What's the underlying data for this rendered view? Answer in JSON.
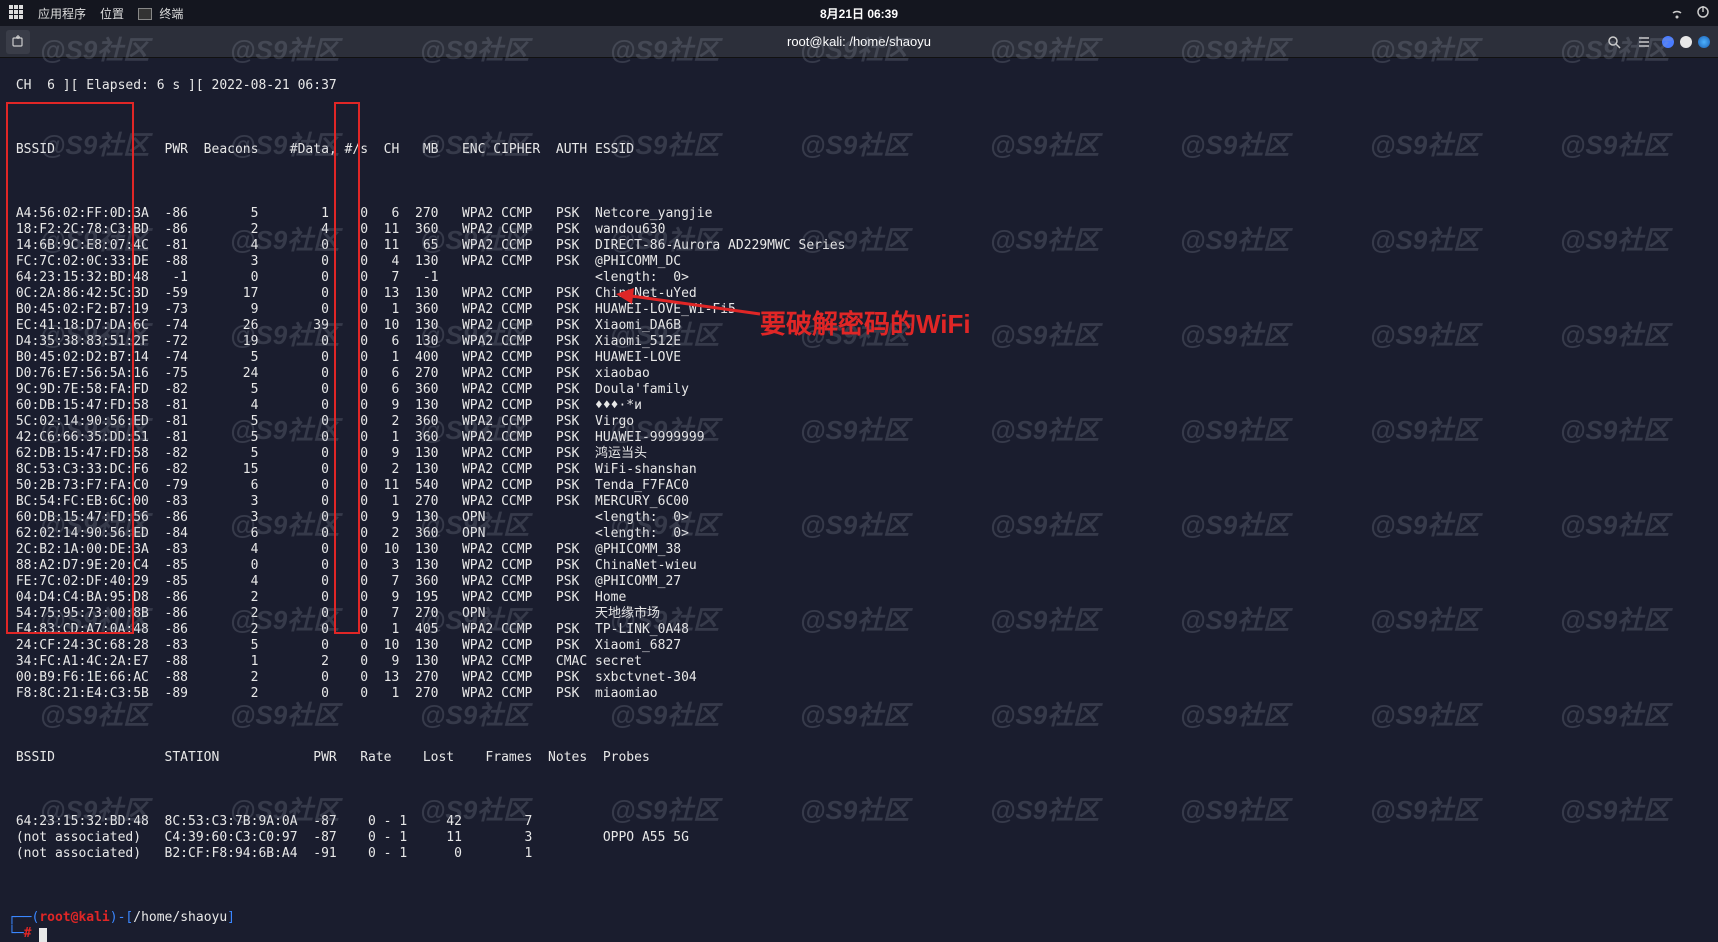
{
  "topbar": {
    "apps": "应用程序",
    "places": "位置",
    "terminal": "终端",
    "clock": "8月21日 06:39"
  },
  "titlebar": {
    "title": "root@kali: /home/shaoyu"
  },
  "watermark_text": "@S9社区",
  "header_line": " CH  6 ][ Elapsed: 6 s ][ 2022-08-21 06:37",
  "columns_ap": " BSSID              PWR  Beacons    #Data, #/s  CH   MB   ENC CIPHER  AUTH ESSID",
  "ap_rows": [
    " A4:56:02:FF:0D:3A  -86        5        1    0   6  270   WPA2 CCMP   PSK  Netcore_yangjie",
    " 18:F2:2C:78:C3:BD  -86        2        4    0  11  360   WPA2 CCMP   PSK  wandou630",
    " 14:6B:9C:E8:07:4C  -81        4        0    0  11   65   WPA2 CCMP   PSK  DIRECT-86-Aurora AD229MWC Series",
    " FC:7C:02:0C:33:DE  -88        3        0    0   4  130   WPA2 CCMP   PSK  @PHICOMM_DC",
    " 64:23:15:32:BD:48   -1        0        0    0   7   -1                    <length:  0>",
    " 0C:2A:86:42:5C:3D  -59       17        0    0  13  130   WPA2 CCMP   PSK  ChinaNet-uYed",
    " B0:45:02:F2:B7:19  -73        9        0    0   1  360   WPA2 CCMP   PSK  HUAWEI-LOVE_Wi-Fi5",
    " EC:41:18:D7:DA:6C  -74       26       39    0  10  130   WPA2 CCMP   PSK  Xiaomi_DA6B",
    " D4:35:38:83:51:2F  -72       19        0    0   6  130   WPA2 CCMP   PSK  Xiaomi_512E",
    " B0:45:02:D2:B7:14  -74        5        0    0   1  400   WPA2 CCMP   PSK  HUAWEI-LOVE",
    " D0:76:E7:56:5A:16  -75       24        0    0   6  270   WPA2 CCMP   PSK  xiaobao",
    " 9C:9D:7E:58:FA:FD  -82        5        0    0   6  360   WPA2 CCMP   PSK  Doula'family",
    " 60:DB:15:47:FD:58  -81        4        0    0   9  130   WPA2 CCMP   PSK  ♦♦♦·*и",
    " 5C:02:14:90:56:ED  -81        5        0    0   2  360   WPA2 CCMP   PSK  Virgo",
    " 42:C6:66:35:DD:51  -81        5        0    0   1  360   WPA2 CCMP   PSK  HUAWEI-9999999",
    " 62:DB:15:47:FD:58  -82        5        0    0   9  130   WPA2 CCMP   PSK  鸿运当头",
    " 8C:53:C3:33:DC:F6  -82       15        0    0   2  130   WPA2 CCMP   PSK  WiFi-shanshan",
    " 50:2B:73:F7:FA:C0  -79        6        0    0  11  540   WPA2 CCMP   PSK  Tenda_F7FAC0",
    " BC:54:FC:EB:6C:00  -83        3        0    0   1  270   WPA2 CCMP   PSK  MERCURY_6C00",
    " 60:DB:15:47:FD:56  -86        3        0    0   9  130   OPN              <length:  0>",
    " 62:02:14:90:56:ED  -84        6        0    0   2  360   OPN              <length:  0>",
    " 2C:B2:1A:00:DE:3A  -83        4        0    0  10  130   WPA2 CCMP   PSK  @PHICOMM_38",
    " 88:A2:D7:9E:20:C4  -85        0        0    0   3  130   WPA2 CCMP   PSK  ChinaNet-wieu",
    " FE:7C:02:DF:40:29  -85        4        0    0   7  360   WPA2 CCMP   PSK  @PHICOMM_27",
    " 04:D4:C4:BA:95:D8  -86        2        0    0   9  195   WPA2 CCMP   PSK  Home",
    " 54:75:95:73:00:8B  -86        2        0    0   7  270   OPN              天地缘市场",
    " F4:83:CD:A7:0A:48  -86        2        0    0   1  405   WPA2 CCMP   PSK  TP-LINK_0A48",
    " 24:CF:24:3C:68:28  -83        5        0    0  10  130   WPA2 CCMP   PSK  Xiaomi_6827",
    " 34:FC:A1:4C:2A:E7  -88        1        2    0   9  130   WPA2 CCMP   CMAC secret",
    " 00:B9:F6:1E:66:AC  -88        2        0    0  13  270   WPA2 CCMP   PSK  sxbctvnet-304",
    " F8:8C:21:E4:C3:5B  -89        2        0    0   1  270   WPA2 CCMP   PSK  miaomiao"
  ],
  "columns_sta": " BSSID              STATION            PWR   Rate    Lost    Frames  Notes  Probes",
  "sta_rows": [
    " 64:23:15:32:BD:48  8C:53:C3:7B:9A:0A  -87    0 - 1     42        7",
    " (not associated)   C4:39:60:C3:C0:97  -87    0 - 1     11        3         OPPO A55 5G",
    " (not associated)   B2:CF:F8:94:6B:A4  -91    0 - 1      0        1"
  ],
  "prompt": {
    "user": "root",
    "at": "@",
    "host": "kali",
    "cwd": "/home/shaoyu"
  },
  "annotation_text": "要破解密码的WiFi"
}
